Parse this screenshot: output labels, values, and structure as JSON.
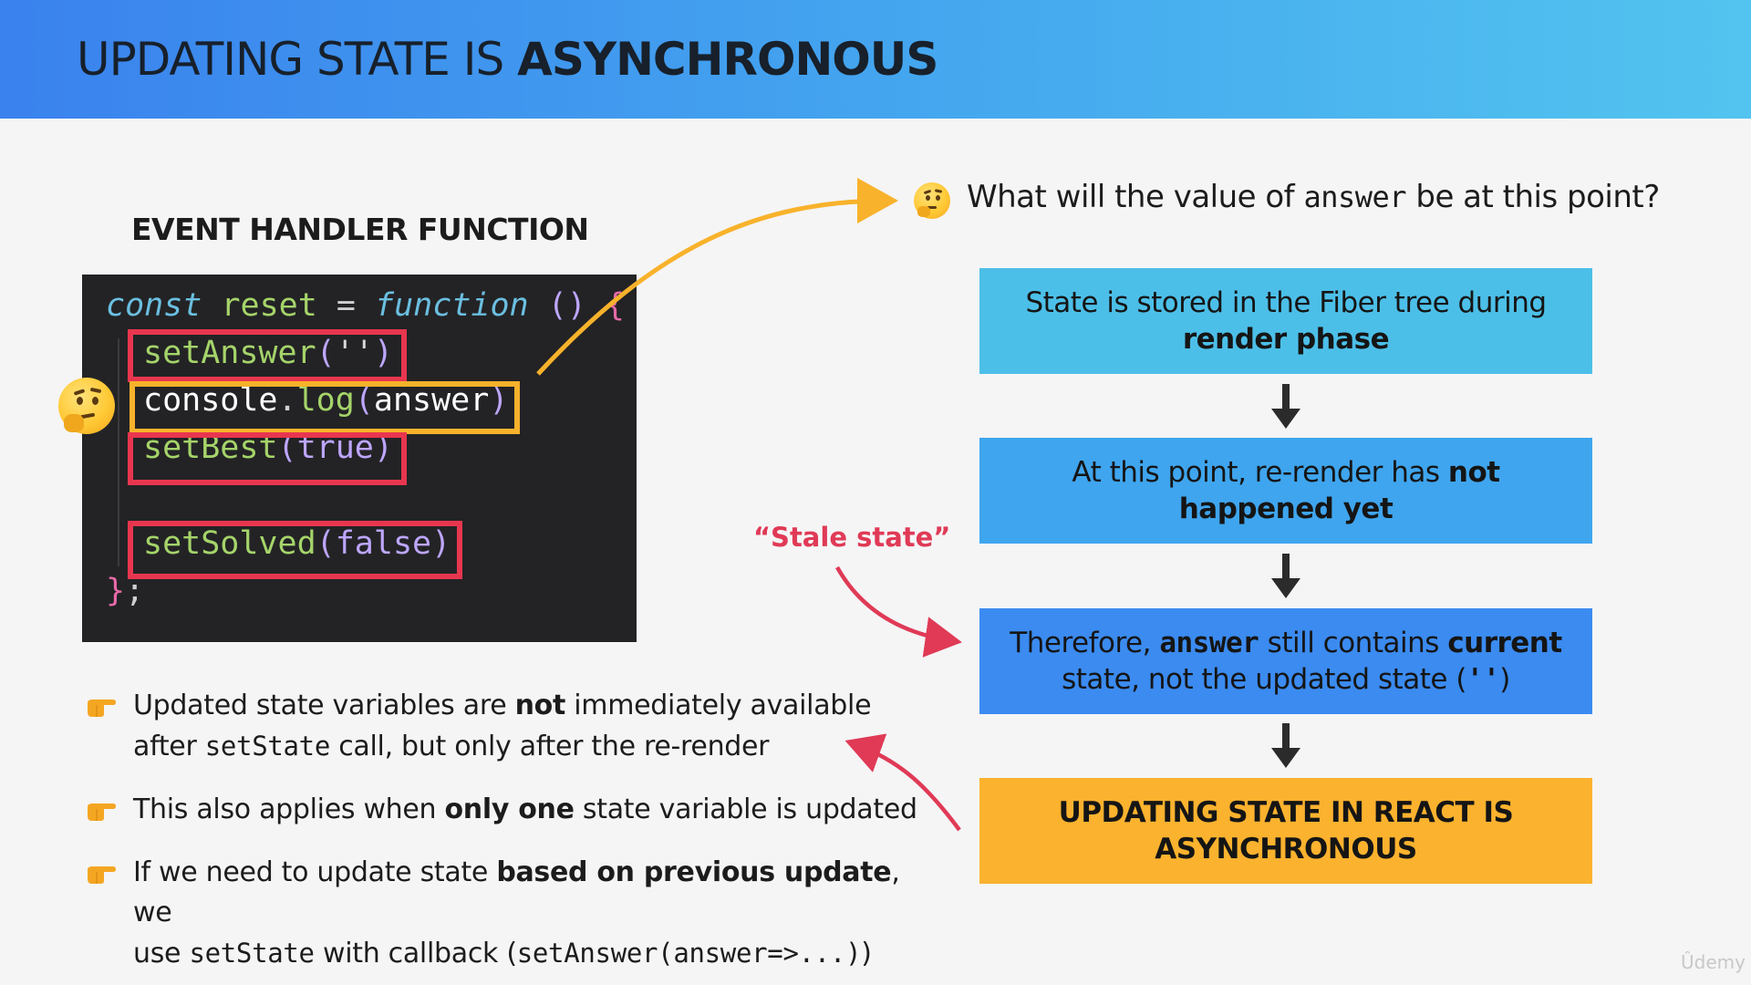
{
  "title": {
    "regular": "UPDATING STATE IS ",
    "bold": "ASYNCHRONOUS"
  },
  "section_label": "EVENT HANDLER FUNCTION",
  "code": {
    "l1_const": "const",
    "l1_name": "reset",
    "l1_eq": "=",
    "l1_function": "function",
    "l1_parens": "()",
    "l1_brace": "{",
    "l2_fn": "setAnswer",
    "l2_open": "(",
    "l2_arg": "''",
    "l2_close": ")",
    "l3_obj": "console",
    "l3_dot": ".",
    "l3_fn": "log",
    "l3_open": "(",
    "l3_arg": "answer",
    "l3_close": ")",
    "l4_fn": "setBest",
    "l4_open": "(",
    "l4_arg": "true",
    "l4_close": ")",
    "l5_fn": "setSolved",
    "l5_open": "(",
    "l5_arg": "false",
    "l5_close": ")",
    "l6_brace": "}",
    "l6_semi": ";"
  },
  "question": {
    "pre": "What will the value of ",
    "code": "answer",
    "post": " be at this point?"
  },
  "flow": {
    "box1": "State is stored in the Fiber tree during",
    "box1_bold": "render phase",
    "box2_pre": "At this point, re-render has ",
    "box2_bold1": "not",
    "box2_bold2": "happened yet",
    "box3_pre": "Therefore, ",
    "box3_code": "answer",
    "box3_mid": " still contains ",
    "box3_bold": "current",
    "box3_line2": "state, not the updated state (",
    "box3_code2": "''",
    "box3_end": ")",
    "box4_line1": "UPDATING STATE IN REACT IS",
    "box4_line2": "ASYNCHRONOUS"
  },
  "stale_label": "“Stale state”",
  "bullets": {
    "b1_pre": "Updated state variables are ",
    "b1_bold": "not",
    "b1_post": " immediately available",
    "b1_l2_pre": "after ",
    "b1_l2_code": "setState",
    "b1_l2_post": " call, but only after the re-render",
    "b2_pre": "This also applies when ",
    "b2_bold": "only one",
    "b2_post": " state variable is updated",
    "b3_pre": "If we need to update state ",
    "b3_bold": "based on previous update",
    "b3_post": ", we",
    "b3_l2_pre": "use ",
    "b3_l2_code": "setState",
    "b3_l2_mid": " with callback (",
    "b3_l2_code2": "setAnswer(answer=>...)",
    "b3_l2_end": ")"
  },
  "watermark": "Ûdemy",
  "colors": {
    "header_start": "#3a82ee",
    "header_end": "#52c4ef",
    "highlight_red": "#e8364f",
    "highlight_yellow": "#f8b22b",
    "stale_red": "#e03a56",
    "flow_final": "#fbb22e"
  },
  "icons": [
    "thinking-face-icon",
    "pointing-hand-icon",
    "arrow-down-icon"
  ]
}
